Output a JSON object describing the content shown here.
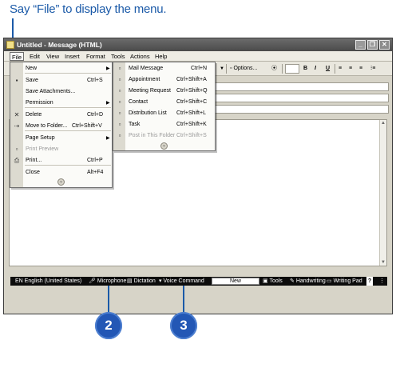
{
  "callout": {
    "text": "Say “File” to display the menu.",
    "badges": [
      "2",
      "3"
    ]
  },
  "window": {
    "title": "Untitled - Message (HTML)",
    "controls": {
      "minimize": "_",
      "restore": "❐",
      "close": "✕"
    }
  },
  "menubar": [
    "File",
    "Edit",
    "View",
    "Insert",
    "Format",
    "Tools",
    "Actions",
    "Help"
  ],
  "toolbar": {
    "options_label": "Options...",
    "format_buttons": [
      "B",
      "I",
      "U"
    ]
  },
  "file_menu": {
    "items": [
      {
        "label": "New",
        "shortcut": "",
        "submenu": true,
        "icon": "blank-icon",
        "disabled": false
      },
      {
        "label": "Save",
        "shortcut": "Ctrl+S",
        "submenu": false,
        "icon": "save-icon",
        "disabled": false
      },
      {
        "label": "Save Attachments...",
        "shortcut": "",
        "submenu": false,
        "icon": "blank-icon",
        "disabled": false
      },
      {
        "label": "Permission",
        "shortcut": "",
        "submenu": true,
        "icon": "blank-icon",
        "disabled": false
      },
      {
        "label": "Delete",
        "shortcut": "Ctrl+D",
        "submenu": false,
        "icon": "delete-icon",
        "disabled": false
      },
      {
        "label": "Move to Folder...",
        "shortcut": "Ctrl+Shift+V",
        "submenu": false,
        "icon": "move-icon",
        "disabled": false
      },
      {
        "label": "Page Setup",
        "shortcut": "",
        "submenu": true,
        "icon": "blank-icon",
        "disabled": false
      },
      {
        "label": "Print Preview",
        "shortcut": "",
        "submenu": false,
        "icon": "print-preview-icon",
        "disabled": true
      },
      {
        "label": "Print...",
        "shortcut": "Ctrl+P",
        "submenu": false,
        "icon": "print-icon",
        "disabled": false
      },
      {
        "label": "Close",
        "shortcut": "Alt+F4",
        "submenu": false,
        "icon": "blank-icon",
        "disabled": false
      }
    ],
    "more_label": "⌄"
  },
  "new_submenu": {
    "items": [
      {
        "label": "Mail Message",
        "shortcut": "Ctrl+N",
        "disabled": false
      },
      {
        "label": "Appointment",
        "shortcut": "Ctrl+Shift+A",
        "disabled": false
      },
      {
        "label": "Meeting Request",
        "shortcut": "Ctrl+Shift+Q",
        "disabled": false
      },
      {
        "label": "Contact",
        "shortcut": "Ctrl+Shift+C",
        "disabled": false
      },
      {
        "label": "Distribution List",
        "shortcut": "Ctrl+Shift+L",
        "disabled": false
      },
      {
        "label": "Task",
        "shortcut": "Ctrl+Shift+K",
        "disabled": false
      },
      {
        "label": "Post in This Folder",
        "shortcut": "Ctrl+Shift+S",
        "disabled": true
      }
    ],
    "more_label": "⌄"
  },
  "language_bar": {
    "language": "EN English (United States)",
    "microphone": "Microphone",
    "dictation": "Dictation",
    "voice_command": "Voice Command",
    "status": "New",
    "tools": "Tools",
    "handwriting": "Handwriting",
    "writing_pad": "Writing Pad",
    "help": "?"
  },
  "colors": {
    "accent": "#1b5aa8",
    "badge": "#2357b5"
  }
}
